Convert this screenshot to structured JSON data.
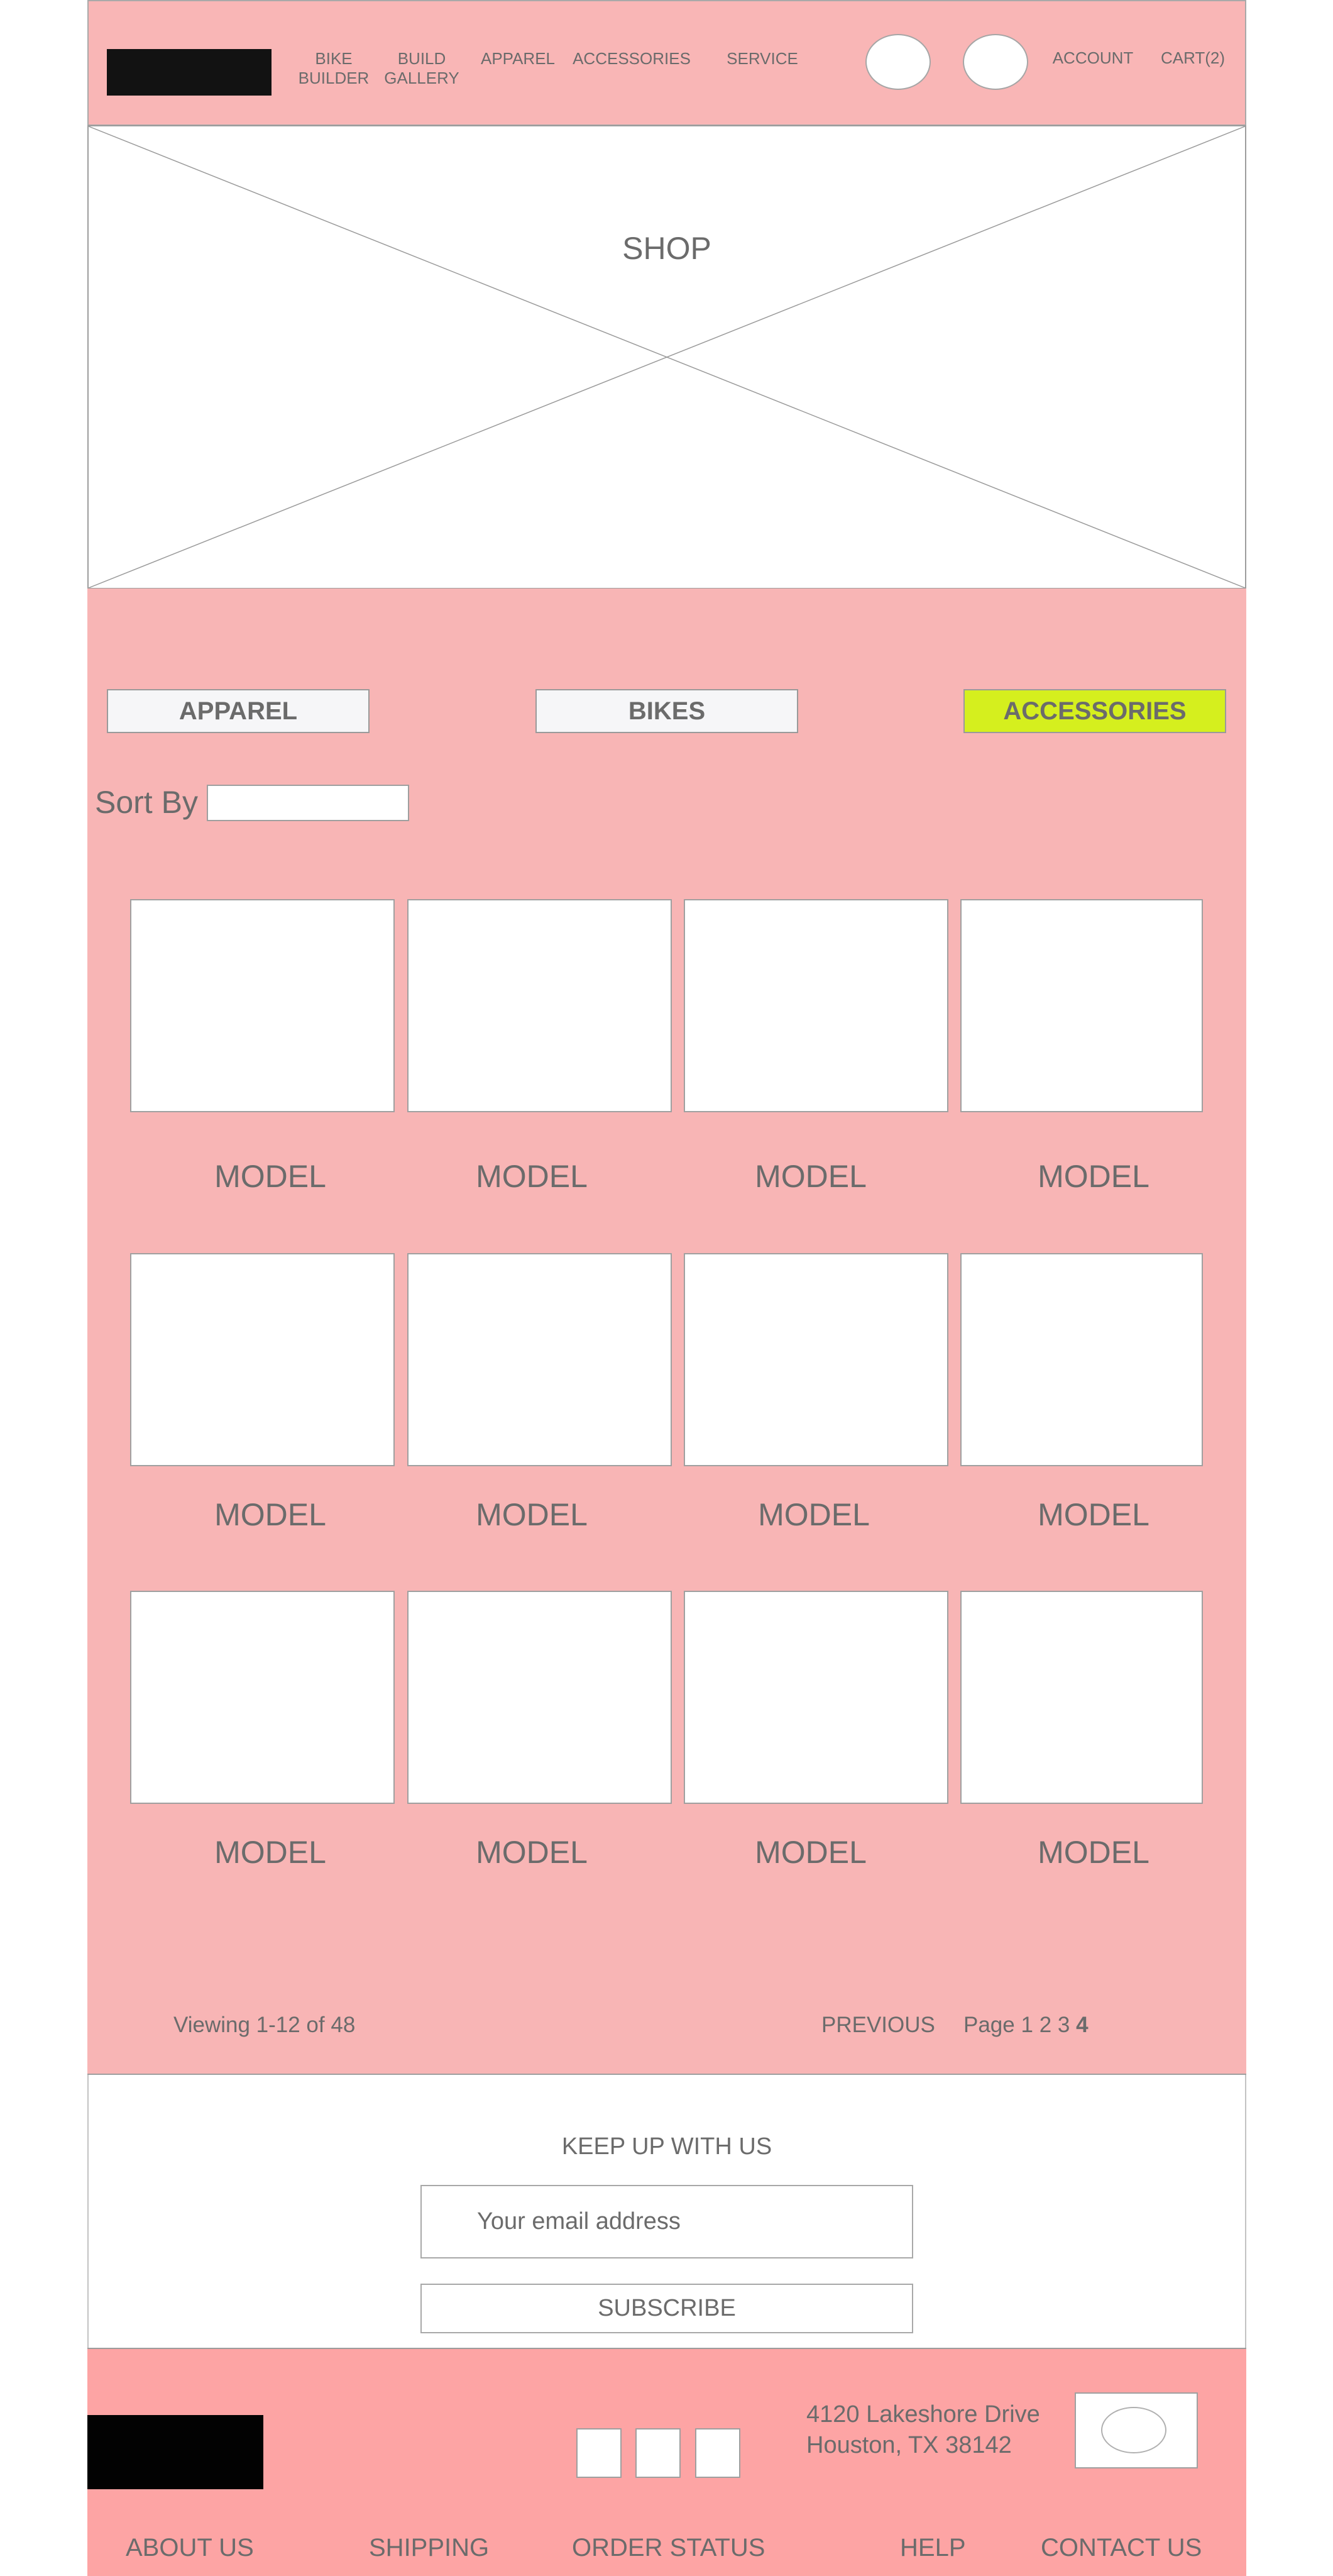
{
  "header": {
    "nav": {
      "bike_builder": "BIKE\nBUILDER",
      "build_gallery": "BUILD\nGALLERY",
      "apparel": "APPAREL",
      "accessories": "ACCESSORIES",
      "service": "SERVICE",
      "account": "ACCOUNT",
      "cart": "CART(2)"
    }
  },
  "hero": {
    "title": "SHOP"
  },
  "categories": {
    "apparel": "APPAREL",
    "bikes": "BIKES",
    "accessories": "ACCESSORIES",
    "active": "ACCESSORIES",
    "active_color": "#d5ef1e"
  },
  "sort": {
    "label": "Sort By",
    "value": ""
  },
  "products": {
    "rows": [
      [
        "MODEL",
        "MODEL",
        "MODEL",
        "MODEL"
      ],
      [
        "MODEL",
        "MODEL",
        "MODEL",
        "MODEL"
      ],
      [
        "MODEL",
        "MODEL",
        "MODEL",
        "MODEL"
      ]
    ]
  },
  "pagination": {
    "viewing": "Viewing 1-12 of 48",
    "previous": "PREVIOUS",
    "page_label": "Page",
    "pages": [
      "1",
      "2",
      "3",
      "4"
    ],
    "current_page": "4"
  },
  "newsletter": {
    "title": "KEEP UP WITH US",
    "email_placeholder": "Your email address",
    "subscribe": "SUBSCRIBE"
  },
  "footer": {
    "address_line1": "4120 Lakeshore Drive",
    "address_line2": "Houston, TX 38142",
    "links": {
      "about": "ABOUT US",
      "shipping": "SHIPPING",
      "order_status": "ORDER STATUS",
      "help": "HELP",
      "contact": "CONTACT US"
    }
  },
  "colors": {
    "header_bg": "#f9b6b6",
    "shop_bg": "#f8b5b5",
    "footer_bg": "#fda4a4",
    "active_tab": "#d5ef1e"
  }
}
